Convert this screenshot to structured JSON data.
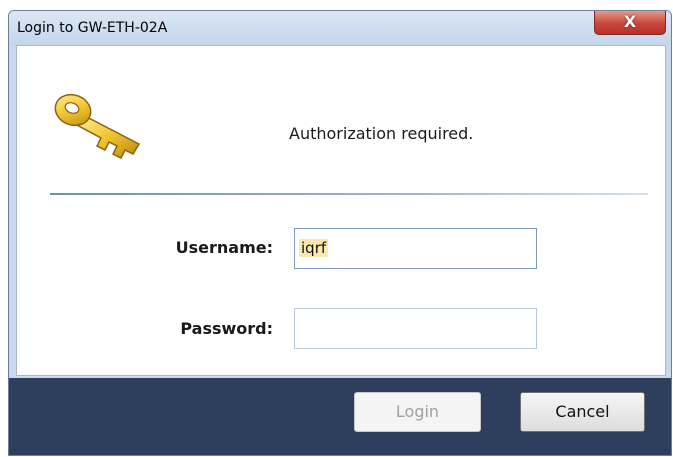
{
  "window": {
    "title": "Login to GW-ETH-02A",
    "close_glyph": "X"
  },
  "header": {
    "icon": "key-icon",
    "message": "Authorization required."
  },
  "form": {
    "username_label": "Username:",
    "username_value": "iqrf",
    "password_label": "Password:",
    "password_value": ""
  },
  "footer": {
    "login_label": "Login",
    "cancel_label": "Cancel"
  },
  "colors": {
    "footer_bg": "#2d3f5c",
    "close_red": "#c7473a",
    "key_gold": "#f2c531"
  }
}
